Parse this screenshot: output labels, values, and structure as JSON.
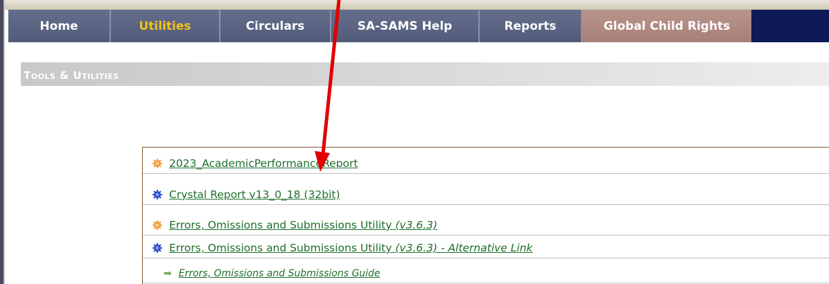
{
  "nav": {
    "items": [
      {
        "label": "Home",
        "width": 0
      },
      {
        "label": "Utilities"
      },
      {
        "label": "Circulars"
      },
      {
        "label": "SA-SAMS Help"
      },
      {
        "label": "Reports"
      },
      {
        "label": "Global Child Rights"
      }
    ],
    "active_color": "#f3c21c"
  },
  "section": {
    "title": "Tools & Utilities"
  },
  "links": [
    {
      "label": "2023_AcademicPerformanceReport",
      "bullet": "orange-gear-icon"
    },
    {
      "label": "Crystal Report v13_0_18 (32bit)",
      "bullet": "blue-gear-icon"
    },
    {
      "label": "Errors, Omissions and Submissions Utility ",
      "version": "(v3.6.3)",
      "bullet": "orange-gear-icon"
    },
    {
      "label": "Errors, Omissions and Submissions Utility ",
      "version": "(v3.6.3) - Alternative Link",
      "bullet": "blue-gear-icon"
    },
    {
      "label": "Errors, Omissions and Submissions Guide",
      "bullet": "green-arrow-icon"
    }
  ],
  "colors": {
    "nav_bg": "#0e1a57",
    "link": "#1e6e2c",
    "orange_bullet": "#f0a040",
    "blue_bullet": "#3050d0",
    "annotation_arrow": "#e00000"
  }
}
